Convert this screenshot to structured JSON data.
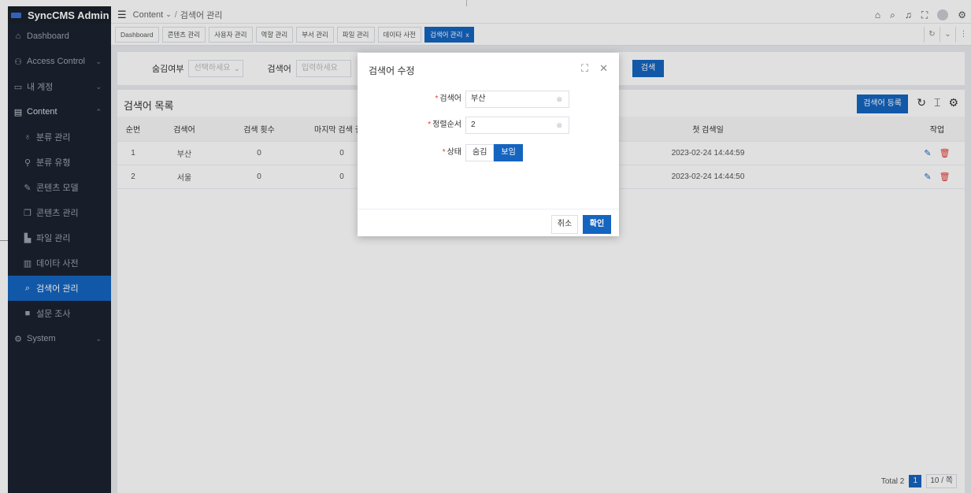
{
  "app": {
    "name": "SyncCMS Admin"
  },
  "sidebar": {
    "items": [
      {
        "label": "Dashboard",
        "icon": "home-icon"
      },
      {
        "label": "Access Control",
        "icon": "user-icon",
        "expandable": true
      },
      {
        "label": "내 계정",
        "icon": "id-card-icon",
        "expandable": true
      },
      {
        "label": "Content",
        "icon": "document-icon",
        "expandable": true,
        "expanded": true
      },
      {
        "label": "분류 관리",
        "icon": "tree-icon",
        "sub": true
      },
      {
        "label": "분류 유형",
        "icon": "sitemap-icon",
        "sub": true
      },
      {
        "label": "콘텐츠 모델",
        "icon": "edit-icon",
        "sub": true
      },
      {
        "label": "콘텐츠 관리",
        "icon": "copy-icon",
        "sub": true
      },
      {
        "label": "파일 관리",
        "icon": "files-icon",
        "sub": true
      },
      {
        "label": "데이타 사전",
        "icon": "book-icon",
        "sub": true
      },
      {
        "label": "검색어 관리",
        "icon": "search-icon",
        "sub": true,
        "active": true
      },
      {
        "label": "설문 조사",
        "icon": "survey-icon",
        "sub": true
      },
      {
        "label": "System",
        "icon": "system-icon",
        "expandable": true
      }
    ]
  },
  "breadcrumb": {
    "parent": "Content",
    "current": "검색어 관리"
  },
  "tabs": [
    {
      "label": "Dashboard"
    },
    {
      "label": "콘텐츠 관리"
    },
    {
      "label": "사용자 관리"
    },
    {
      "label": "역할 관리"
    },
    {
      "label": "부서 관리"
    },
    {
      "label": "파일 관리"
    },
    {
      "label": "데이타 사전"
    },
    {
      "label": "검색어 관리",
      "active": true
    }
  ],
  "search": {
    "hidden_label": "숨김여부",
    "hidden_placeholder": "선택하세요",
    "keyword_label": "검색어",
    "keyword_placeholder": "입력하세요",
    "button": "검색"
  },
  "table": {
    "title": "검색어 목록",
    "add_button": "검색어 등록",
    "columns": [
      "순번",
      "검색어",
      "검색 횟수",
      "마지막 검색 결과",
      "첫 검색일",
      "작업"
    ],
    "rows": [
      {
        "no": "1",
        "keyword": "부산",
        "count": "0",
        "last": "0",
        "first": "2023-02-24 14:44:59"
      },
      {
        "no": "2",
        "keyword": "서울",
        "count": "0",
        "last": "0",
        "first": "2023-02-24 14:44:50"
      }
    ],
    "pager": {
      "total": "Total 2",
      "page": "1",
      "size": "10 / 쪽"
    }
  },
  "dialog": {
    "title": "검색어 수정",
    "keyword_label": "검색어",
    "keyword_value": "부산",
    "order_label": "정렬순서",
    "order_value": "2",
    "status_label": "상태",
    "status_hide": "숨김",
    "status_show": "보임",
    "cancel": "취소",
    "confirm": "확인"
  },
  "colors": {
    "primary": "#1565c0",
    "sidebar": "#1b2330",
    "danger": "#e53935"
  }
}
